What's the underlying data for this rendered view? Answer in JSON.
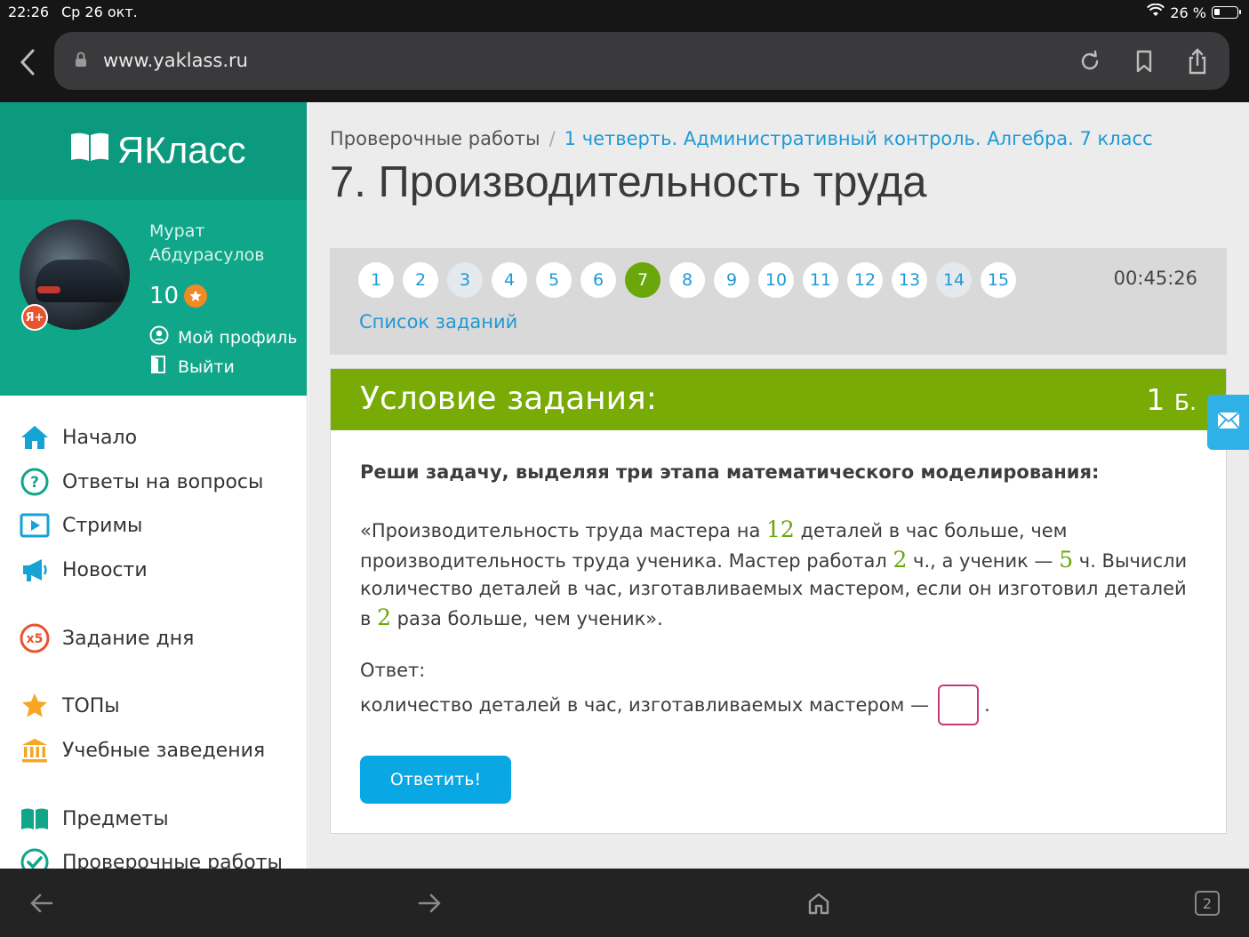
{
  "statusbar": {
    "time": "22:26",
    "date": "Ср 26 окт.",
    "battery": "26 %"
  },
  "browser": {
    "url": "www.yaklass.ru",
    "tabs_count": "2"
  },
  "logo": {
    "text": "ЯКласс"
  },
  "profile": {
    "first_name": "Мурат",
    "last_name": "Абдурасулов",
    "score": "10",
    "badge": "Я+",
    "my_profile": "Мой профиль",
    "logout": "Выйти"
  },
  "nav": {
    "home": "Начало",
    "answers": "Ответы на вопросы",
    "streams": "Стримы",
    "news": "Новости",
    "daily": "Задание дня",
    "daily_badge": "x5",
    "tops": "ТОПы",
    "schools": "Учебные заведения",
    "subjects": "Предметы",
    "tests": "Проверочные работы"
  },
  "breadcrumb": {
    "root": "Проверочные работы",
    "separator": "/",
    "current": "1 четверть. Административный контроль. Алгебра. 7 класс"
  },
  "page_title": "7. Производительность труда",
  "task_nav": {
    "pages": [
      "1",
      "2",
      "3",
      "4",
      "5",
      "6",
      "7",
      "8",
      "9",
      "10",
      "11",
      "12",
      "13",
      "14",
      "15"
    ],
    "active_page": "7",
    "timer": "00:45:26",
    "task_list": "Список заданий"
  },
  "condition": {
    "header": "Условие задания:",
    "points": "1",
    "points_unit": "Б.",
    "instruction": "Реши задачу, выделяя три этапа математического моделирования:",
    "text": {
      "p1": "«Производительность труда мастера на ",
      "n1": "12",
      "p2": " деталей в час больше, чем производительность труда ученика. Мастер работал ",
      "n2": "2",
      "p3": " ч., а ученик — ",
      "n3": "5",
      "p4": " ч. Вычисли количество деталей в час, изготавливаемых мастером, если он изготовил деталей в ",
      "n4": "2",
      "p5": " раза больше, чем ученик»."
    },
    "answer_label": "Ответ:",
    "answer_prefix": "количество деталей в час, изготавливаемых мастером —",
    "answer_suffix": ".",
    "answer_value": "",
    "submit": "Ответить!"
  },
  "colors": {
    "brand_green": "#0fa68a",
    "header_green": "#78ab05",
    "active_page": "#6aa70a",
    "link_blue": "#1e9ad6",
    "button_blue": "#09a7e4"
  }
}
